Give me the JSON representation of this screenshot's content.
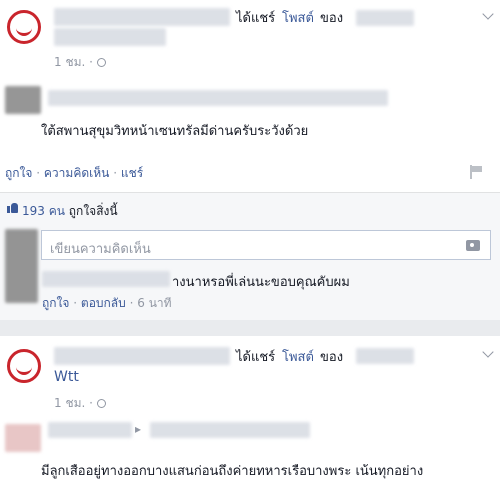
{
  "post1": {
    "shared_text": "ได้แชร์",
    "post_link": "โพสต์",
    "of_text": "ของ",
    "time": "1 ชม.",
    "separator": "·",
    "body": "ใต้สพานสุขุมวิทหน้าเซนทรัลมีด่านครับระวังด้วย",
    "actions": {
      "like": "ถูกใจ",
      "comment": "ความคิดเห็น",
      "share": "แชร์",
      "sep": "·"
    },
    "likes": {
      "count": "193 คน",
      "label": "ถูกใจสิ่งนี้"
    },
    "comment_input": {
      "placeholder": "เขียนความคิดเห็น"
    },
    "comment": {
      "text": "างนาหรอพี่เล่นนะขอบคุณคับผม",
      "like": "ถูกใจ",
      "reply": "ตอบกลับ",
      "time": "6 นาที",
      "sep": "·"
    }
  },
  "post2": {
    "shared_text": "ได้แชร์",
    "post_link": "โพสต์",
    "of_text": "ของ",
    "caption": "Wtt",
    "time": "1 ชม.",
    "separator": "·",
    "body": "มีลูกเสืออยู่ทางออกบางแสนก่อนถึงค่ายทหารเรือบางพระ เน้นทุกอย่าง",
    "arrow": "▸"
  },
  "icons": [
    "avatar",
    "chevron-down-icon",
    "globe-icon",
    "flag-icon",
    "thumbs-up-icon",
    "camera-icon"
  ],
  "colors": {
    "link": "#3b5998",
    "grey": "#9197a3",
    "background": "#e9ebee",
    "brand_red": "#c9252c"
  }
}
